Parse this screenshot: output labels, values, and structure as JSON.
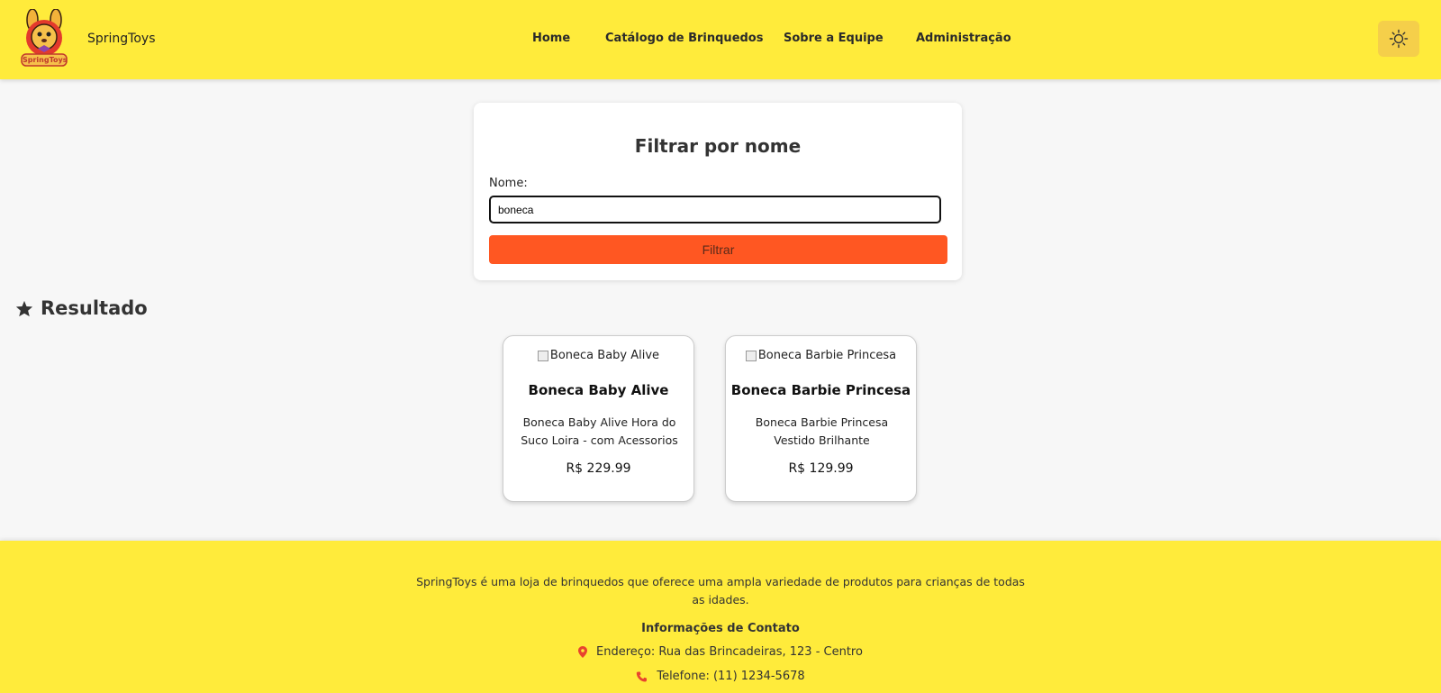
{
  "header": {
    "brand": "SpringToys",
    "logo_text": "SpringToys",
    "nav": [
      {
        "label": "Home"
      },
      {
        "label": "Catálogo de Brinquedos"
      },
      {
        "label": "Sobre a Equipe"
      },
      {
        "label": "Administração"
      }
    ]
  },
  "filter": {
    "title": "Filtrar por nome",
    "label": "Nome:",
    "value": "boneca",
    "button": "Filtrar"
  },
  "results": {
    "title": "Resultado",
    "products": [
      {
        "image_alt": "Boneca Baby Alive",
        "name": "Boneca Baby Alive",
        "description": "Boneca Baby Alive Hora do Suco Loira - com Acessorios",
        "price": "R$ 229.99"
      },
      {
        "image_alt": "Boneca Barbie Princesa",
        "name": "Boneca Barbie Princesa",
        "description": "Boneca Barbie Princesa Vestido Brilhante",
        "price": "R$ 129.99"
      }
    ]
  },
  "footer": {
    "about": "SpringToys é uma loja de brinquedos que oferece uma ampla variedade de produtos para crianças de todas as idades.",
    "contact_title": "Informações de Contato",
    "address": "Endereço: Rua das Brincadeiras, 123 - Centro",
    "phone": "Telefone: (11) 1234-5678"
  },
  "colors": {
    "header_bg": "#ffeb3b",
    "accent": "#ff5722",
    "icon_red": "#e8442e"
  },
  "icons": {
    "theme_toggle": "sun-icon",
    "results": "star-icon",
    "address": "map-pin-icon",
    "phone": "phone-icon"
  }
}
